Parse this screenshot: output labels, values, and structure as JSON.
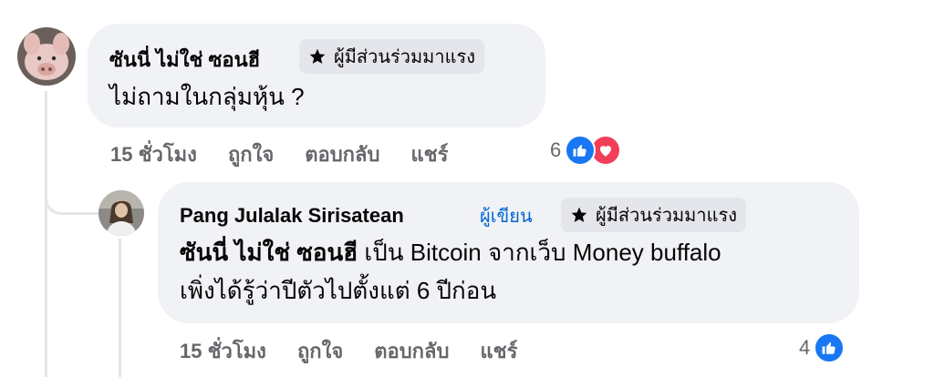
{
  "comments": [
    {
      "author": "ซันนี่ ไม่ใช่ ซอนฮี",
      "badge": "ผู้มีส่วนร่วมมาแรง",
      "text": "ไม่ถามในกลุ่มหุ้น ?",
      "time": "15 ชั่วโมง",
      "like_label": "ถูกใจ",
      "reply_label": "ตอบกลับ",
      "share_label": "แชร์",
      "reaction_count": "6",
      "reactions": [
        "like",
        "love"
      ],
      "avatar_icon": "pig-avatar"
    },
    {
      "author": "Pang Julalak Sirisatean",
      "author_badge": "ผู้เขียน",
      "badge": "ผู้มีส่วนร่วมมาแรง",
      "mention": "ซันนี่ ไม่ใช่ ซอนฮี",
      "text_line1": " เป็น Bitcoin จากเว็บ Money buffalo",
      "text_line2": "เพิ่งได้รู้ว่าปีตัวไปตั้งแต่ 6 ปีก่อน",
      "time": "15 ชั่วโมง",
      "like_label": "ถูกใจ",
      "reply_label": "ตอบกลับ",
      "share_label": "แชร์",
      "reaction_count": "4",
      "reactions": [
        "like"
      ],
      "avatar_icon": "person-avatar"
    }
  ],
  "colors": {
    "bubble": "#f0f2f5",
    "like_blue": "#1877f2",
    "love_red": "#f33e58",
    "author_badge_blue": "#0064d1",
    "meta_gray": "#65676b"
  }
}
